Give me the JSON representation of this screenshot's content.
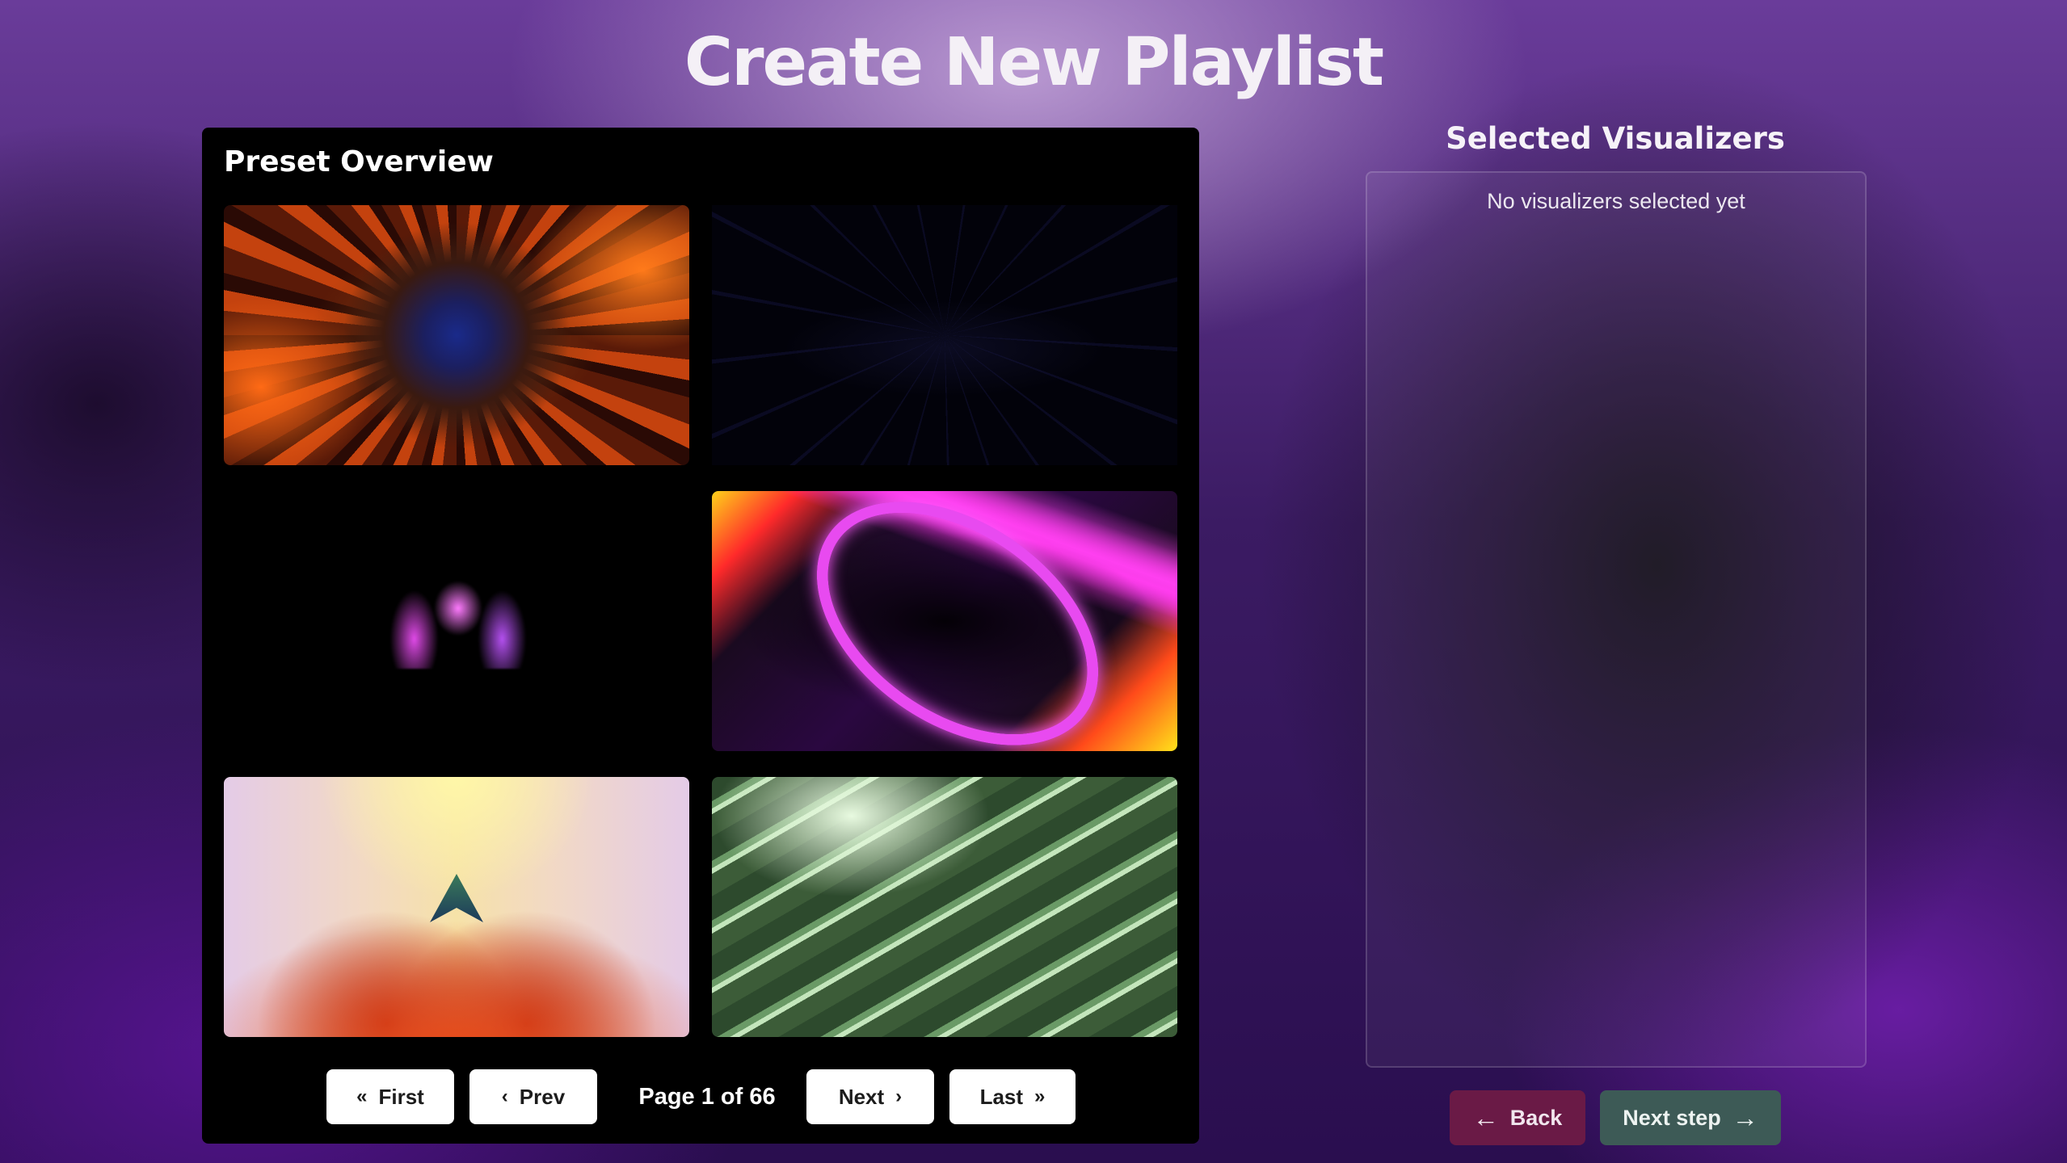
{
  "page": {
    "title": "Create New Playlist"
  },
  "preset_panel": {
    "title": "Preset Overview",
    "thumbnails": [
      {
        "icon": "orange-kaleidoscope-thumbnail"
      },
      {
        "icon": "dark-starfield-thumbnail"
      },
      {
        "icon": "magenta-bird-thumbnail"
      },
      {
        "icon": "neon-spiral-thumbnail"
      },
      {
        "icon": "symmetric-wings-thumbnail"
      },
      {
        "icon": "green-liquid-thumbnail"
      }
    ],
    "pagination": {
      "first_label": "First",
      "prev_label": "Prev",
      "page_info": "Page 1 of 66",
      "next_label": "Next",
      "last_label": "Last"
    }
  },
  "selected": {
    "title": "Selected Visualizers",
    "empty_text": "No visualizers selected yet"
  },
  "footer": {
    "back_label": "Back",
    "next_step_label": "Next step"
  },
  "colors": {
    "back_button": "#6a1a46",
    "next_step_button": "#3d5a56",
    "panel_bg": "#000000"
  }
}
